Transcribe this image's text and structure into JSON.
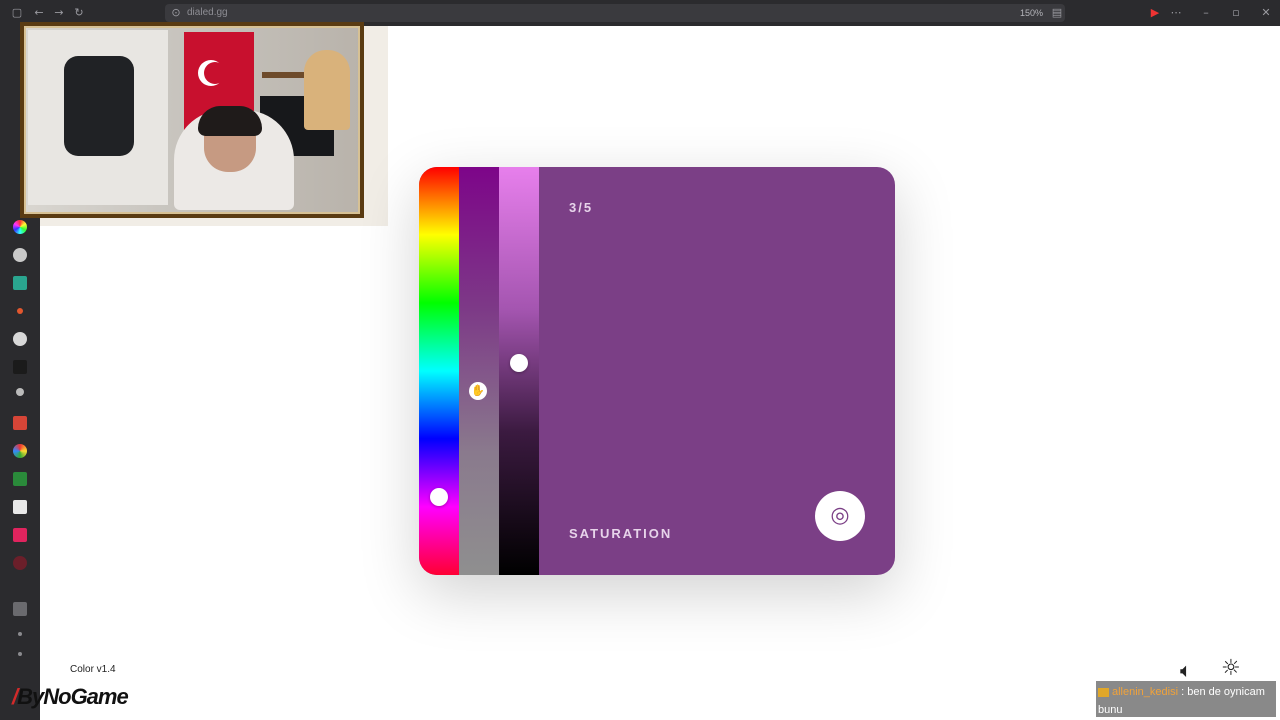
{
  "browser": {
    "url": "dialed.gg",
    "zoom": "150%"
  },
  "sidebar": {
    "icons": [
      "color-app-icon",
      "globe-icon",
      "z-icon",
      "dot-icon",
      "circle-icon",
      "grid-icon",
      "w-icon",
      "gmail-icon",
      "chrome-icon",
      "app-icon",
      "notion-icon",
      "bi-icon",
      "pin-icon",
      "download-icon",
      "dot-icon",
      "dot-icon"
    ]
  },
  "game": {
    "counter": "3/5",
    "mode": "SATURATION",
    "color": "#7b3f86",
    "hue_position": 0.81,
    "saturation_position": 0.55,
    "brightness_position": 0.48
  },
  "footer": {
    "version": "Color v1.4",
    "brand": "ByNoGame"
  },
  "chat": {
    "user": "allenin_kedisi",
    "separator": " : ",
    "message": "ben de oynicam bunu"
  }
}
